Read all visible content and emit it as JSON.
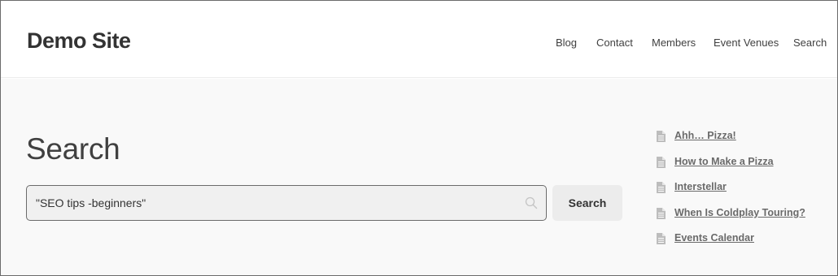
{
  "header": {
    "site_title": "Demo Site",
    "nav": [
      "Blog",
      "Contact",
      "Members",
      "Event Venues",
      "Search"
    ]
  },
  "main": {
    "page_title": "Search",
    "search": {
      "value": "\"SEO tips -beginners\"",
      "button_label": "Search",
      "icon": "search-icon"
    }
  },
  "sidebar": {
    "items": [
      {
        "label": "Ahh… Pizza!",
        "icon": "document-icon"
      },
      {
        "label": "How to Make a Pizza",
        "icon": "document-icon"
      },
      {
        "label": "Interstellar",
        "icon": "document-icon"
      },
      {
        "label": "When Is Coldplay Touring?",
        "icon": "document-icon"
      },
      {
        "label": "Events Calendar",
        "icon": "document-icon"
      }
    ]
  },
  "colors": {
    "text": "#333333",
    "nav_text": "#404040",
    "link": "#6a6a6a",
    "main_bg": "#f9f9f9",
    "input_bg": "#f0f0f0",
    "button_bg": "#ececec"
  }
}
